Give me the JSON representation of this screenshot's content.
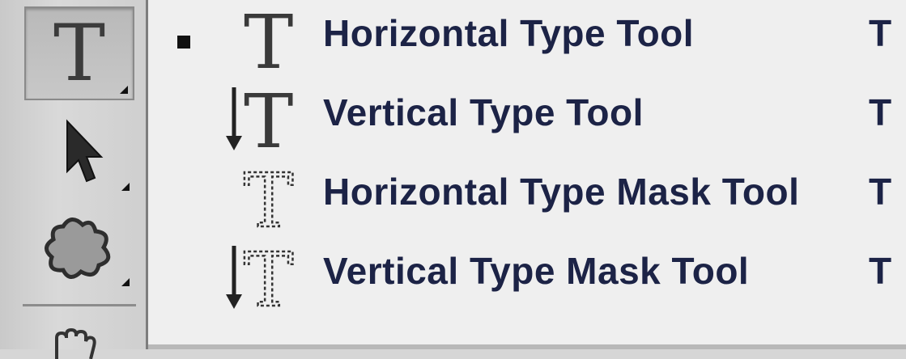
{
  "toolbar": {
    "tools": [
      {
        "icon": "type-tool-icon",
        "glyph": "T",
        "active": true
      },
      {
        "icon": "move-arrow-tool-icon",
        "active": false
      },
      {
        "icon": "custom-shape-tool-icon",
        "active": false
      },
      {
        "icon": "hand-tool-icon",
        "active": false
      }
    ]
  },
  "menu": {
    "items": [
      {
        "label": "Horizontal Type Tool",
        "shortcut": "T",
        "selected": true,
        "icon": "horizontal-type-icon"
      },
      {
        "label": "Vertical Type Tool",
        "shortcut": "T",
        "selected": false,
        "icon": "vertical-type-icon"
      },
      {
        "label": "Horizontal Type Mask Tool",
        "shortcut": "T",
        "selected": false,
        "icon": "horizontal-type-mask-icon"
      },
      {
        "label": "Vertical Type Mask Tool",
        "shortcut": "T",
        "selected": false,
        "icon": "vertical-type-mask-icon"
      }
    ]
  },
  "colors": {
    "menu_bg": "#efefef",
    "label_text": "#1c2346",
    "toolbar_bg": "#d0d0d0"
  }
}
